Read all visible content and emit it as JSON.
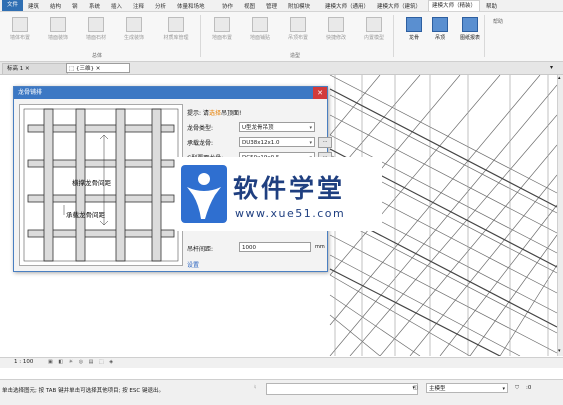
{
  "menu": {
    "file": "文件",
    "items": [
      "建筑",
      "结构",
      "钢",
      "系统",
      "插入",
      "注释",
      "分析",
      "体量和场地",
      "协作",
      "视图",
      "管理",
      "附加模块",
      "建模大师（通用）",
      "建模大师（建筑）",
      "建模大师（精装）",
      "帮助"
    ],
    "active": "建模大师（精装）"
  },
  "ribbon": {
    "buttons": [
      "墙体布置",
      "墙面装饰",
      "墙面石材",
      "生成装饰",
      "材质库管理",
      "地面布置",
      "地面铺贴",
      "吊顶布置",
      "快捷修改",
      "内置模型"
    ],
    "active_buttons": [
      "龙骨",
      "吊顶",
      "图纸报表"
    ],
    "groups": [
      "总体",
      "造型",
      "帮助"
    ]
  },
  "tabs": [
    {
      "label": "标高 1"
    },
    {
      "label": "{三维}"
    }
  ],
  "dialog": {
    "title": "龙骨铺排",
    "close": "✕",
    "hint_prefix": "提示: 请",
    "hint_link": "选择",
    "hint_suffix": "吊顶面!",
    "fields": [
      {
        "label": "龙骨类型:",
        "value": "U型龙骨吊顶",
        "more": false
      },
      {
        "label": "承载龙骨:",
        "value": "DU38x12x1.0",
        "more": true
      },
      {
        "label": "C型覆面龙骨:",
        "value": "DC50x19x0.5",
        "more": true
      }
    ],
    "hanger_label": "吊杆间距:",
    "hanger_value": "1000",
    "hanger_unit": "mm",
    "settings_link": "设置",
    "preview_label_1": "横撑龙骨间距",
    "preview_label_2": "承载龙骨间距"
  },
  "watermark": {
    "title": "软件学堂",
    "url": "www.xue51.com"
  },
  "viewbar": {
    "scale": "1 : 100"
  },
  "statusbar": {
    "message": "单击选择图元; 按 TAB 键并单击可选择其他项目; 按 ESC 键退出。",
    "model_combo": "主模型",
    "zero": ":0"
  },
  "colors": {
    "accent": "#3c78c4",
    "link": "#e67e00",
    "watermark": "#1f3f80"
  }
}
